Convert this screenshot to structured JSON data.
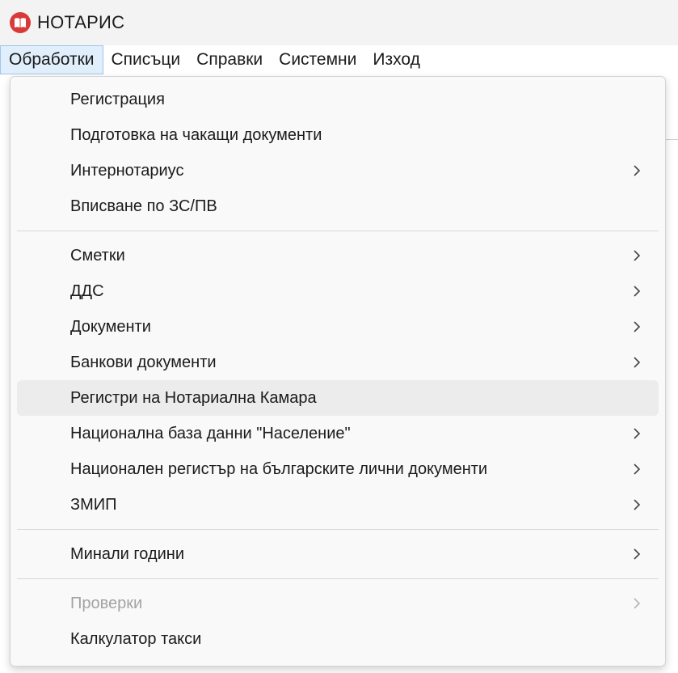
{
  "window": {
    "title": "НОТАРИС",
    "icon": "book-icon",
    "icon_color": "#d83a3a"
  },
  "menubar": {
    "items": [
      {
        "label": "Обработки",
        "active": true
      },
      {
        "label": "Списъци"
      },
      {
        "label": "Справки"
      },
      {
        "label": "Системни"
      },
      {
        "label": "Изход"
      }
    ]
  },
  "dropdown": {
    "items": [
      {
        "label": "Регистрация",
        "submenu": false
      },
      {
        "label": "Подготовка на чакащи документи",
        "submenu": false
      },
      {
        "label": "Интернотариус",
        "submenu": true
      },
      {
        "label": "Вписване по ЗС/ПВ",
        "submenu": false
      },
      {
        "label": "Сметки",
        "submenu": true
      },
      {
        "label": "ДДС",
        "submenu": true
      },
      {
        "label": "Документи",
        "submenu": true
      },
      {
        "label": "Банкови документи",
        "submenu": true
      },
      {
        "label": "Регистри на Нотариална Камара",
        "submenu": false,
        "hovered": true
      },
      {
        "label": "Национална база данни \"Население\"",
        "submenu": true
      },
      {
        "label": "Национален регистър на българските лични документи",
        "submenu": true
      },
      {
        "label": "ЗМИП",
        "submenu": true
      },
      {
        "label": "Минали години",
        "submenu": true
      },
      {
        "label": "Проверки",
        "submenu": true,
        "disabled": true
      },
      {
        "label": "Калкулатор такси",
        "submenu": false
      }
    ]
  },
  "colors": {
    "menubar_active_bg": "#e1eefb",
    "menubar_active_border": "#9fc5ec",
    "hover_bg": "#ececec",
    "disabled_text": "#a3a3a3"
  }
}
